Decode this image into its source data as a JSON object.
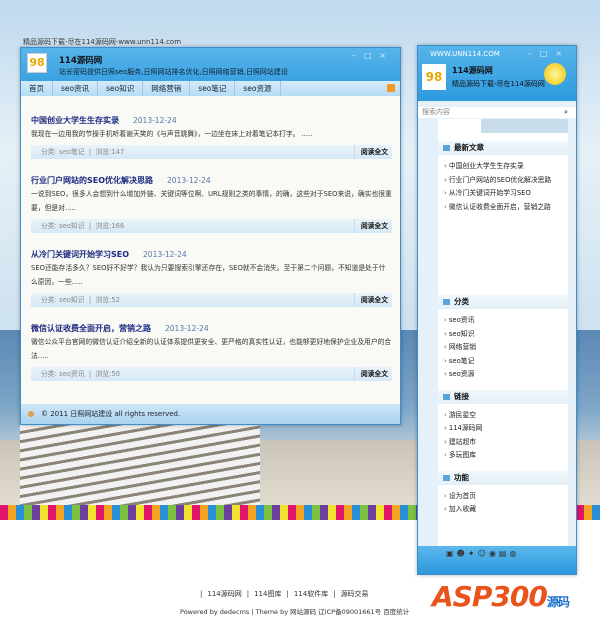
{
  "top_note": "精品源码下载-尽在114源码网-www.unn114.com",
  "main": {
    "title": "114源码网",
    "subtitle": "站长密码提供日照seo服务,日照网站排名优化,日照网络营销,日照网站建设",
    "nav": [
      "首页",
      "seo资讯",
      "seo知识",
      "网络营销",
      "seo笔记",
      "seo资源"
    ],
    "read_more": "阅读全文",
    "articles": [
      {
        "title": "中国创业大学生生存实录",
        "date": "2013-12-24",
        "summary": "我现在一边用我的节操手机听着谢天笑的《与声音跳舞》，一边坐在床上对着笔记本打字。 .....",
        "category": "分类: seo笔记",
        "views": "浏览:147"
      },
      {
        "title": "行业门户网站的SEO优化解决思路",
        "date": "2013-12-24",
        "summary": "一说到SEO，很多人会想到什么增加外链、关键词等位啊、URL规则之类的事情，的确，这些对于SEO来说，确实也很重要，但是对.....",
        "category": "分类: seo知识",
        "views": "浏览:166"
      },
      {
        "title": "从冷门关键词开始学习SEO",
        "date": "2013-12-24",
        "summary": "SEO还能存活多久？SEO好不好学？我认为只要搜索引擎还存在，SEO就不会消失。至于第二个问题，不知道是处于什么原因，一些.....",
        "category": "分类: seo知识",
        "views": "浏览:52"
      },
      {
        "title": "微信认证收费全面开启，营销之路",
        "date": "2013-12-24",
        "summary": "微信公众平台官网的微信认证介绍全新的认证体系提供更安全、更严格的真实性认证，也能够更好地保护企业及用户的合法.....",
        "category": "分类: seo资讯",
        "views": "浏览:50"
      }
    ],
    "footer": "© 2011 日照网站建设  all rights reserved."
  },
  "side": {
    "url": "WWW.UNN114.COM",
    "name": "114源码网",
    "sub": "精品源码下载-尽在114源码网",
    "search_placeholder": "搜索内容",
    "sections": [
      {
        "title": "最新文章",
        "items": [
          "中国创业大学生生存实录",
          "行业门户网站的SEO优化解决思路",
          "从冷门关键词开始学习SEO",
          "微信认证收费全面开启，营销之路"
        ]
      },
      {
        "title": "分类",
        "items": [
          "seo资讯",
          "seo知识",
          "网络营销",
          "seo笔记",
          "seo资源"
        ]
      },
      {
        "title": "链接",
        "items": [
          "游民星空",
          "114源码网",
          "建站超市",
          "多玩图库"
        ]
      },
      {
        "title": "功能",
        "items": [
          "设为首页",
          "加入收藏"
        ]
      }
    ]
  },
  "footer": {
    "links": [
      "114源码网",
      "114图库",
      "114软件库",
      "源码交易"
    ],
    "powered": "Powered by dedecms | Theme by 网站源码 辽ICP备09001661号 百度统计",
    "watermark": "ASP300",
    "watermark_sub": "源码"
  }
}
